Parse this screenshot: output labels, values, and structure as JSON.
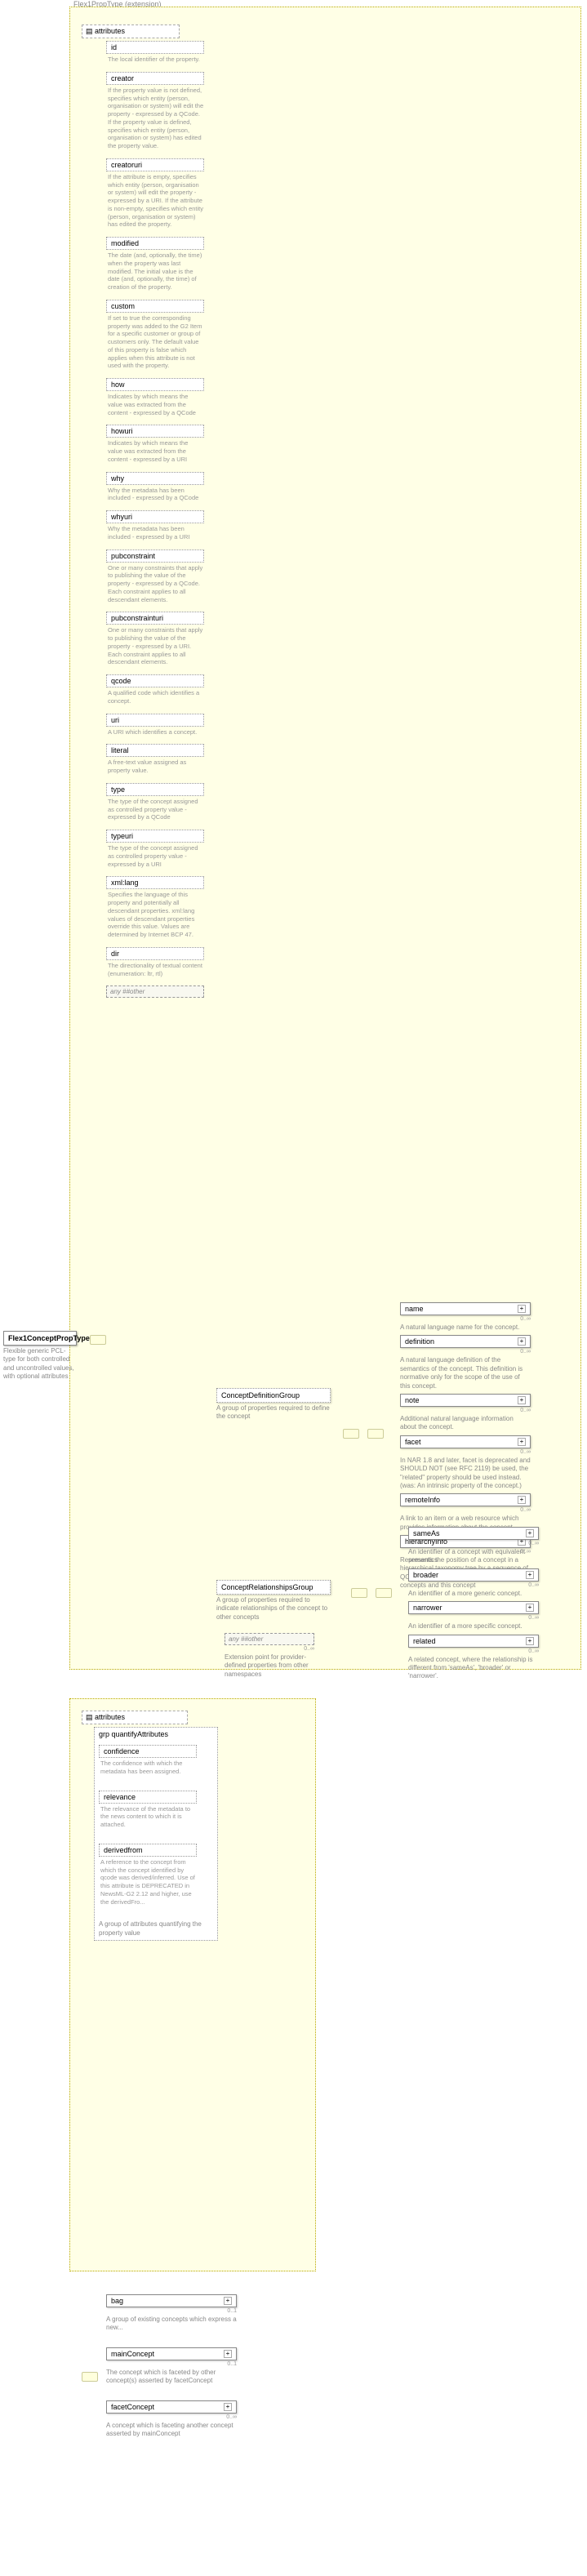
{
  "ext_label": "Flex1PropType (extension)",
  "main_type": {
    "name": "Flex1ConceptPropType",
    "desc": "Flexible generic PCL-type for both controlled and uncontrolled values, with optional attributes"
  },
  "attributes_label": "attributes",
  "attrs": [
    {
      "name": "id",
      "desc": "The local identifier of the property.",
      "solid": false
    },
    {
      "name": "creator",
      "desc": "If the property value is not defined, specifies which entity (person, organisation or system) will edit the property - expressed by a QCode. If the property value is defined, specifies which entity (person, organisation or system) has edited the property value.",
      "solid": false
    },
    {
      "name": "creatoruri",
      "desc": "If the attribute is empty, specifies which entity (person, organisation or system) will edit the property - expressed by a URI. If the attribute is non-empty, specifies which entity (person, organisation or system) has edited the property.",
      "solid": false
    },
    {
      "name": "modified",
      "desc": "The date (and, optionally, the time) when the property was last modified. The initial value is the date (and, optionally, the time) of creation of the property.",
      "solid": false
    },
    {
      "name": "custom",
      "desc": "If set to true the corresponding property was added to the G2 Item for a specific customer or group of customers only. The default value of this property is false which applies when this attribute is not used with the property.",
      "solid": false
    },
    {
      "name": "how",
      "desc": "Indicates by which means the value was extracted from the content - expressed by a QCode",
      "solid": false
    },
    {
      "name": "howuri",
      "desc": "Indicates by which means the value was extracted from the content - expressed by a URI",
      "solid": false
    },
    {
      "name": "why",
      "desc": "Why the metadata has been included - expressed by a QCode",
      "solid": false
    },
    {
      "name": "whyuri",
      "desc": "Why the metadata has been included - expressed by a URI",
      "solid": false
    },
    {
      "name": "pubconstraint",
      "desc": "One or many constraints that apply to publishing the value of the property - expressed by a QCode. Each constraint applies to all descendant elements.",
      "solid": false
    },
    {
      "name": "pubconstrainturi",
      "desc": "One or many constraints that apply to publishing the value of the property - expressed by a URI. Each constraint applies to all descendant elements.",
      "solid": false
    },
    {
      "name": "qcode",
      "desc": "A qualified code which identifies a concept.",
      "solid": false
    },
    {
      "name": "uri",
      "desc": "A URI which identifies a concept.",
      "solid": false
    },
    {
      "name": "literal",
      "desc": "A free-text value assigned as property value.",
      "solid": false
    },
    {
      "name": "type",
      "desc": "The type of the concept assigned as controlled property value - expressed by a QCode",
      "solid": false
    },
    {
      "name": "typeuri",
      "desc": "The type of the concept assigned as controlled property value - expressed by a URI",
      "solid": false
    },
    {
      "name": "xml:lang",
      "desc": "Specifies the language of this property and potentially all descendant properties. xml:lang values of descendant properties override this value. Values are determined by Internet BCP 47.",
      "solid": false
    },
    {
      "name": "dir",
      "desc": "The directionality of textual content (enumeration: ltr, rtl)",
      "solid": false
    }
  ],
  "attrs_other": "any ##other",
  "cdg": {
    "name": "ConceptDefinitionGroup",
    "desc": "A group of properties required to define the concept"
  },
  "crg": {
    "name": "ConceptRelationshipsGroup",
    "desc": "A group of properties required to indicate relationships of the concept to other concepts"
  },
  "any_other": {
    "label": "any ##other",
    "mult": "0..∞",
    "desc": "Extension point for provider-defined properties from other namespaces"
  },
  "cdg_children": [
    {
      "name": "name",
      "mult": "0..∞",
      "desc": "A natural language name for the concept."
    },
    {
      "name": "definition",
      "mult": "0..∞",
      "desc": "A natural language definition of the semantics of the concept. This definition is normative only for the scope of the use of this concept."
    },
    {
      "name": "note",
      "mult": "0..∞",
      "desc": "Additional natural language information about the concept."
    },
    {
      "name": "facet",
      "mult": "0..∞",
      "desc": "In NAR 1.8 and later, facet is deprecated and SHOULD NOT (see RFC 2119) be used, the \"related\" property should be used instead. (was: An intrinsic property of the concept.)"
    },
    {
      "name": "remoteInfo",
      "mult": "0..∞",
      "desc": "A link to an item or a web resource which provides information about the concept"
    },
    {
      "name": "hierarchyInfo",
      "mult": "0..∞",
      "desc": "Represents the position of a concept in a hierarchical taxonomy tree by a sequence of QCode tokens representing the ancestor concepts and this concept"
    }
  ],
  "crg_children": [
    {
      "name": "sameAs",
      "mult": "0..∞",
      "desc": "An identifier of a concept with equivalent semantics"
    },
    {
      "name": "broader",
      "mult": "0..∞",
      "desc": "An identifier of a more generic concept."
    },
    {
      "name": "narrower",
      "mult": "0..∞",
      "desc": "An identifier of a more specific concept."
    },
    {
      "name": "related",
      "mult": "0..∞",
      "desc": "A related concept, where the relationship is different from 'sameAs', 'broader' or 'narrower'."
    }
  ],
  "qa_label": "grp quantifyAttributes",
  "qa_items": [
    {
      "name": "confidence",
      "desc": "The confidence with which the metadata has been assigned."
    },
    {
      "name": "relevance",
      "desc": "The relevance of the metadata to the news content to which it is attached."
    },
    {
      "name": "derivedfrom",
      "desc": "A reference to the concept from which the concept identified by qcode was derived/inferred. Use of this attribute is DEPRECATED in NewsML-G2 2.12 and higher, use the derivedFro..."
    }
  ],
  "qa_desc": "A group of attributes quantifying the property value",
  "bottom": [
    {
      "name": "bag",
      "mult": "0..1",
      "desc": "A group of existing concepts which express a new..."
    },
    {
      "name": "mainConcept",
      "mult": "0..1",
      "desc": "The concept which is faceted by other concept(s) asserted by facetConcept"
    },
    {
      "name": "facetConcept",
      "mult": "0..∞",
      "desc": "A concept which is faceting another concept asserted by mainConcept"
    }
  ],
  "attributes_label2": "attributes"
}
